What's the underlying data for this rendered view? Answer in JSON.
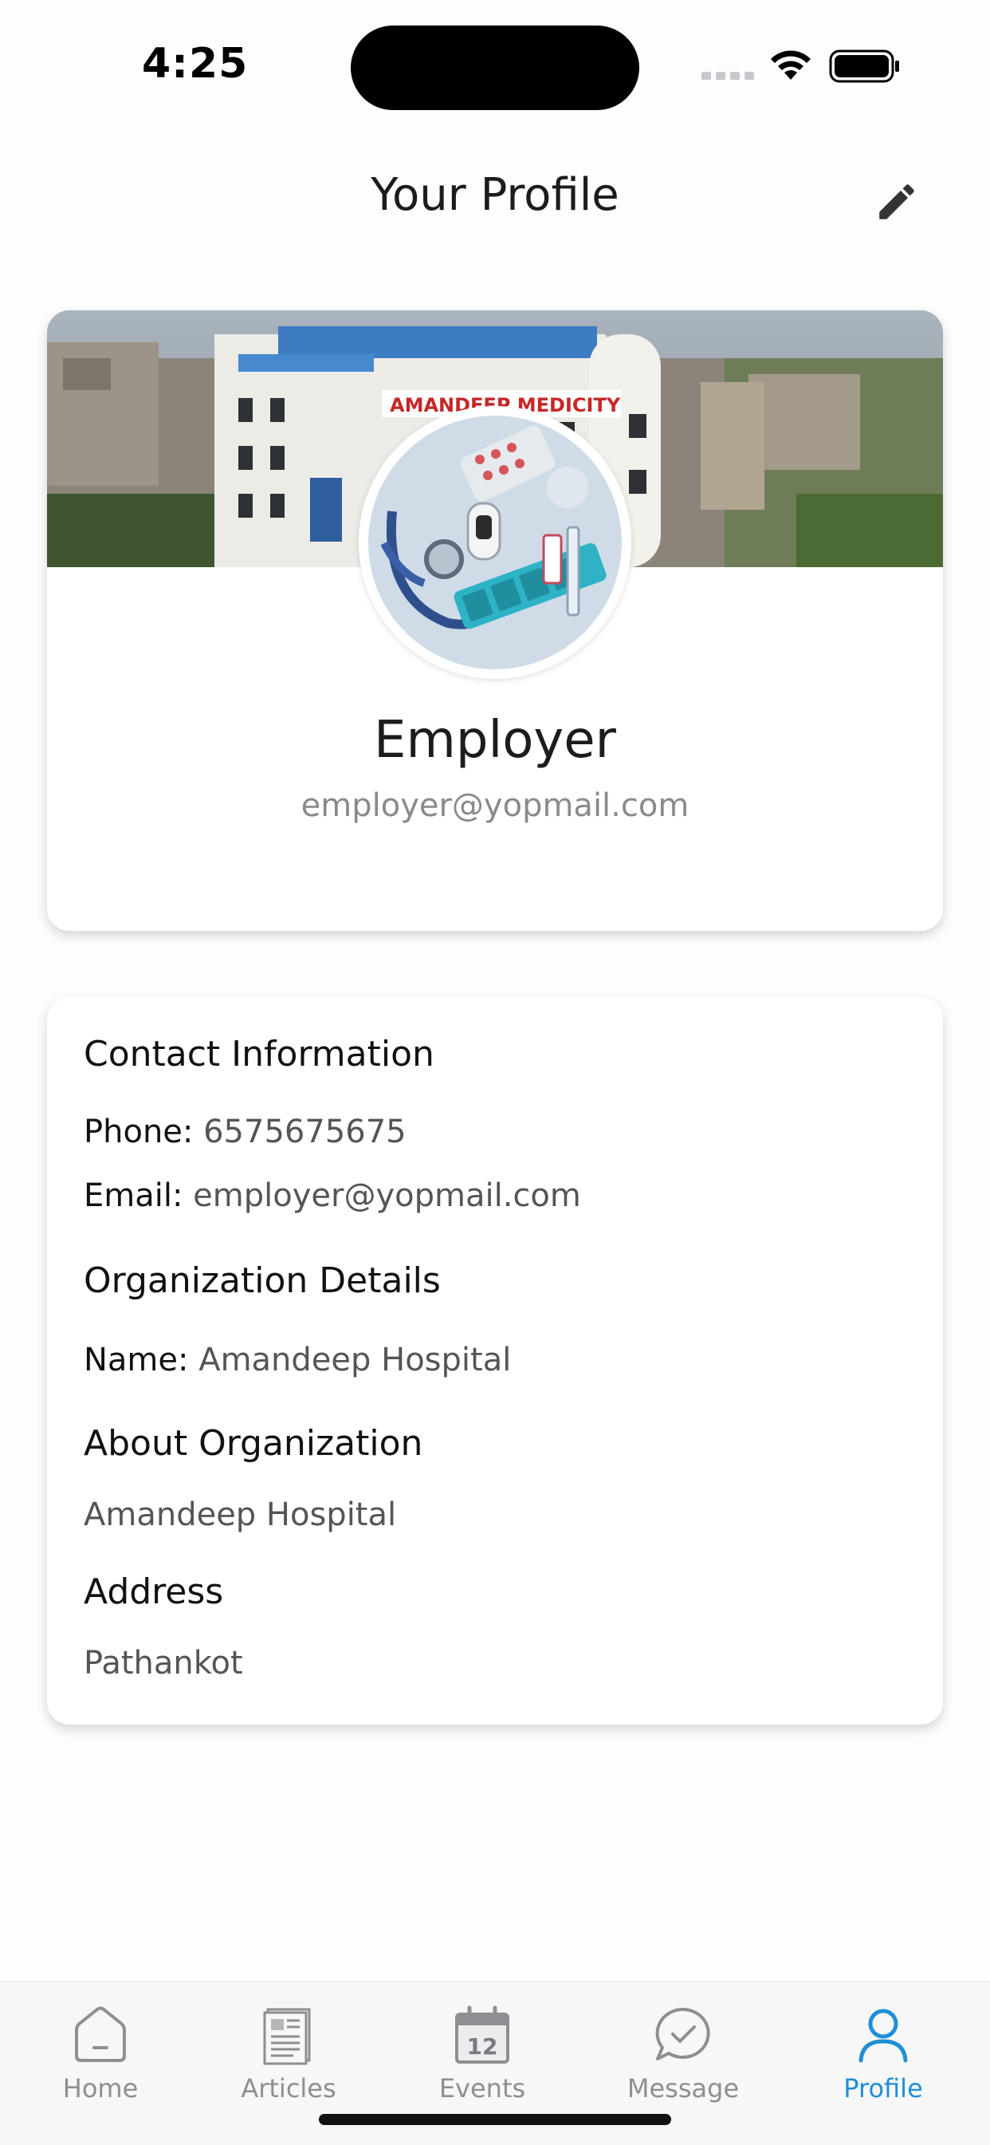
{
  "status_bar": {
    "time": "4:25"
  },
  "header": {
    "title": "Your Profile",
    "edit_icon": "pencil-icon"
  },
  "profile": {
    "name": "Employer",
    "email": "employer@yopmail.com",
    "banner_sign": "AMANDEEP MEDICITY"
  },
  "contact": {
    "title": "Contact Information",
    "phone_label": "Phone:",
    "phone": "6575675675",
    "email_label": "Email:",
    "email": "employer@yopmail.com"
  },
  "organization": {
    "title": "Organization Details",
    "name_label": "Name:",
    "name": "Amandeep Hospital"
  },
  "about": {
    "title": "About Organization",
    "text": "Amandeep Hospital"
  },
  "address": {
    "title": "Address",
    "text": "Pathankot"
  },
  "tabs": [
    {
      "label": "Home",
      "icon": "home-icon"
    },
    {
      "label": "Articles",
      "icon": "articles-icon"
    },
    {
      "label": "Events",
      "icon": "calendar-icon",
      "day": "12"
    },
    {
      "label": "Message",
      "icon": "message-icon"
    },
    {
      "label": "Profile",
      "icon": "profile-icon",
      "active": true
    }
  ],
  "colors": {
    "accent": "#1f8fd6",
    "inactive": "#8e8e93"
  }
}
